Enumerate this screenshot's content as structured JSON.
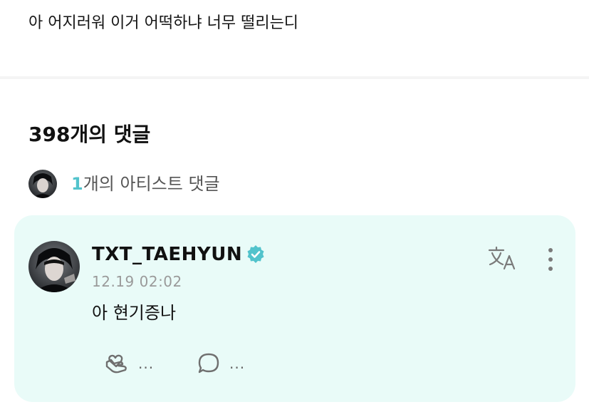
{
  "post": {
    "text": "아 어지러워 이거 어떡하냐 너무 떨리는디"
  },
  "comments_section": {
    "count_title": "398개의 댓글",
    "artist_row": {
      "count": "1",
      "label": "개의 아티스트 댓글"
    }
  },
  "comment": {
    "author": "TXT_TAEHYUN",
    "time": "12.19 02:02",
    "text": "아 현기증나",
    "like_count": "...",
    "reply_count": "..."
  },
  "colors": {
    "card_bg": "#e9fbf8",
    "accent": "#52c3cc",
    "verified": "#52c3cc",
    "icon_gray": "#7a7a7a"
  },
  "icons": {
    "verified": "verified-badge-icon",
    "translate": "translate-icon",
    "more": "more-vertical-icon",
    "like": "heart-hand-icon",
    "reply": "speech-bubble-icon"
  }
}
